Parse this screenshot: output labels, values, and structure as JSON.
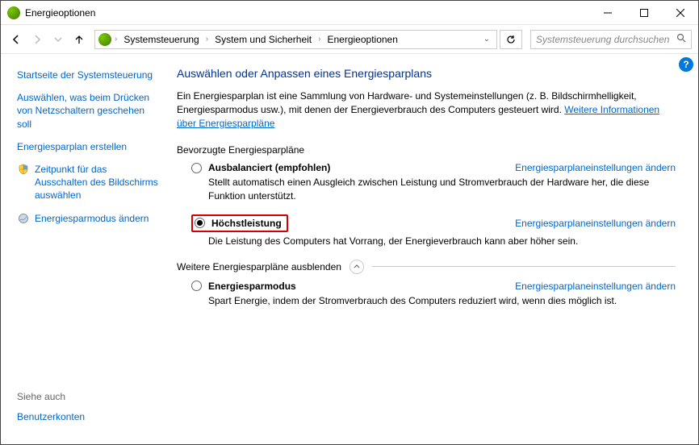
{
  "window": {
    "title": "Energieoptionen"
  },
  "breadcrumbs": {
    "b1": "Systemsteuerung",
    "b2": "System und Sicherheit",
    "b3": "Energieoptionen"
  },
  "search": {
    "placeholder": "Systemsteuerung durchsuchen"
  },
  "sidebar": {
    "home": "Startseite der Systemsteuerung",
    "l1": "Auswählen, was beim Drücken von Netzschaltern geschehen soll",
    "l2": "Energiesparplan erstellen",
    "l3": "Zeitpunkt für das Ausschalten des Bildschirms auswählen",
    "l4": "Energiesparmodus ändern",
    "see_also": "Siehe auch",
    "ua": "Benutzerkonten"
  },
  "content": {
    "heading": "Auswählen oder Anpassen eines Energiesparplans",
    "desc_pre": "Ein Energiesparplan ist eine Sammlung von Hardware- und Systemeinstellungen (z. B. Bildschirmhelligkeit, Energiesparmodus usw.), mit denen der Energieverbrauch des Computers gesteuert wird. ",
    "desc_link": "Weitere Informationen über Energiesparpläne",
    "section_preferred": "Bevorzugte Energiesparpläne",
    "section_hide": "Weitere Energiesparpläne ausblenden",
    "change_link": "Energiesparplaneinstellungen ändern",
    "plans": {
      "balanced": {
        "name": "Ausbalanciert (empfohlen)",
        "desc": "Stellt automatisch einen Ausgleich zwischen Leistung und Stromverbrauch der Hardware her, die diese Funktion unterstützt."
      },
      "high": {
        "name": "Höchstleistung",
        "desc": "Die Leistung des Computers hat Vorrang, der Energieverbrauch kann aber höher sein."
      },
      "saver": {
        "name": "Energiesparmodus",
        "desc": "Spart Energie, indem der Stromverbrauch des Computers reduziert wird, wenn dies möglich ist."
      }
    }
  }
}
